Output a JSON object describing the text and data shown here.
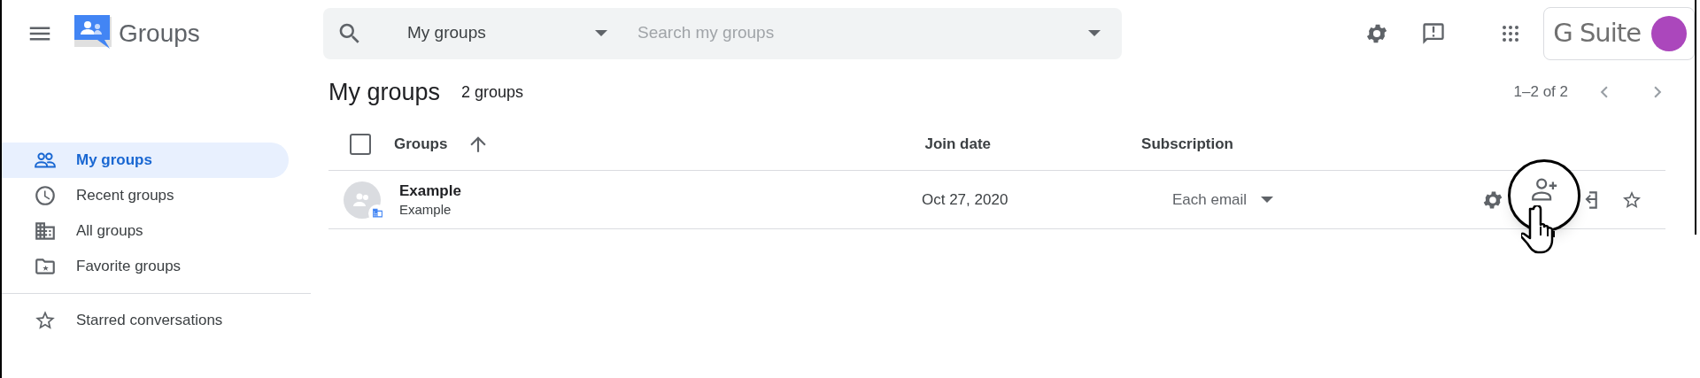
{
  "app": {
    "name": "Groups"
  },
  "search": {
    "scope": "My groups",
    "placeholder": "Search my groups"
  },
  "badge": {
    "label": "G Suite"
  },
  "sidebar": {
    "items": [
      {
        "label": "My groups",
        "selected": true
      },
      {
        "label": "Recent groups",
        "selected": false
      },
      {
        "label": "All groups",
        "selected": false
      },
      {
        "label": "Favorite groups",
        "selected": false
      }
    ],
    "extra": [
      {
        "label": "Starred conversations",
        "selected": false
      }
    ]
  },
  "page": {
    "title": "My groups",
    "count": "2 groups",
    "pagination": "1–2 of 2"
  },
  "table": {
    "select_all": {
      "checked": false
    },
    "columns": [
      "Groups",
      "Join date",
      "Subscription"
    ],
    "rows": [
      {
        "name": "Example",
        "email": "Example",
        "join_date": "Oct 27, 2020",
        "subscription": "Each email"
      }
    ]
  }
}
